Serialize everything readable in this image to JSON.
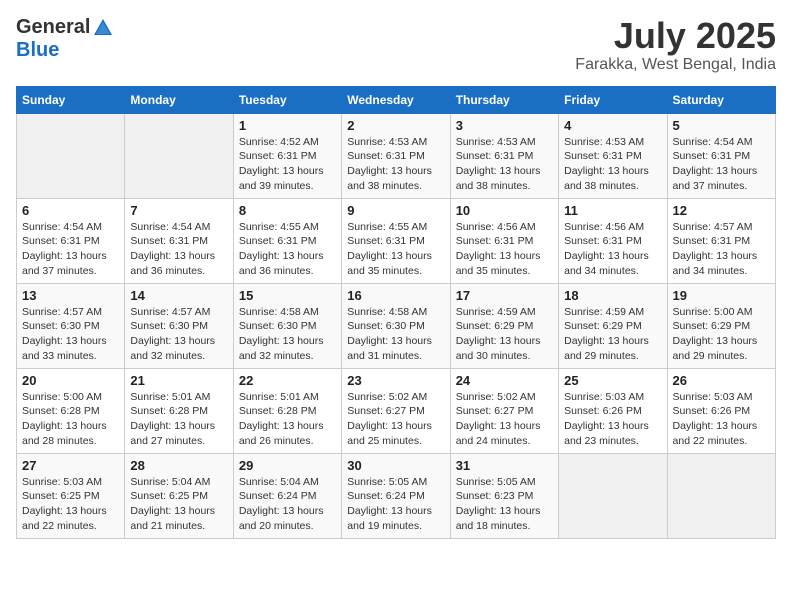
{
  "header": {
    "logo_general": "General",
    "logo_blue": "Blue",
    "month_title": "July 2025",
    "location": "Farakka, West Bengal, India"
  },
  "days_of_week": [
    "Sunday",
    "Monday",
    "Tuesday",
    "Wednesday",
    "Thursday",
    "Friday",
    "Saturday"
  ],
  "weeks": [
    [
      {
        "day": "",
        "info": ""
      },
      {
        "day": "",
        "info": ""
      },
      {
        "day": "1",
        "sunrise": "4:52 AM",
        "sunset": "6:31 PM",
        "daylight": "13 hours and 39 minutes."
      },
      {
        "day": "2",
        "sunrise": "4:53 AM",
        "sunset": "6:31 PM",
        "daylight": "13 hours and 38 minutes."
      },
      {
        "day": "3",
        "sunrise": "4:53 AM",
        "sunset": "6:31 PM",
        "daylight": "13 hours and 38 minutes."
      },
      {
        "day": "4",
        "sunrise": "4:53 AM",
        "sunset": "6:31 PM",
        "daylight": "13 hours and 38 minutes."
      },
      {
        "day": "5",
        "sunrise": "4:54 AM",
        "sunset": "6:31 PM",
        "daylight": "13 hours and 37 minutes."
      }
    ],
    [
      {
        "day": "6",
        "sunrise": "4:54 AM",
        "sunset": "6:31 PM",
        "daylight": "13 hours and 37 minutes."
      },
      {
        "day": "7",
        "sunrise": "4:54 AM",
        "sunset": "6:31 PM",
        "daylight": "13 hours and 36 minutes."
      },
      {
        "day": "8",
        "sunrise": "4:55 AM",
        "sunset": "6:31 PM",
        "daylight": "13 hours and 36 minutes."
      },
      {
        "day": "9",
        "sunrise": "4:55 AM",
        "sunset": "6:31 PM",
        "daylight": "13 hours and 35 minutes."
      },
      {
        "day": "10",
        "sunrise": "4:56 AM",
        "sunset": "6:31 PM",
        "daylight": "13 hours and 35 minutes."
      },
      {
        "day": "11",
        "sunrise": "4:56 AM",
        "sunset": "6:31 PM",
        "daylight": "13 hours and 34 minutes."
      },
      {
        "day": "12",
        "sunrise": "4:57 AM",
        "sunset": "6:31 PM",
        "daylight": "13 hours and 34 minutes."
      }
    ],
    [
      {
        "day": "13",
        "sunrise": "4:57 AM",
        "sunset": "6:30 PM",
        "daylight": "13 hours and 33 minutes."
      },
      {
        "day": "14",
        "sunrise": "4:57 AM",
        "sunset": "6:30 PM",
        "daylight": "13 hours and 32 minutes."
      },
      {
        "day": "15",
        "sunrise": "4:58 AM",
        "sunset": "6:30 PM",
        "daylight": "13 hours and 32 minutes."
      },
      {
        "day": "16",
        "sunrise": "4:58 AM",
        "sunset": "6:30 PM",
        "daylight": "13 hours and 31 minutes."
      },
      {
        "day": "17",
        "sunrise": "4:59 AM",
        "sunset": "6:29 PM",
        "daylight": "13 hours and 30 minutes."
      },
      {
        "day": "18",
        "sunrise": "4:59 AM",
        "sunset": "6:29 PM",
        "daylight": "13 hours and 29 minutes."
      },
      {
        "day": "19",
        "sunrise": "5:00 AM",
        "sunset": "6:29 PM",
        "daylight": "13 hours and 29 minutes."
      }
    ],
    [
      {
        "day": "20",
        "sunrise": "5:00 AM",
        "sunset": "6:28 PM",
        "daylight": "13 hours and 28 minutes."
      },
      {
        "day": "21",
        "sunrise": "5:01 AM",
        "sunset": "6:28 PM",
        "daylight": "13 hours and 27 minutes."
      },
      {
        "day": "22",
        "sunrise": "5:01 AM",
        "sunset": "6:28 PM",
        "daylight": "13 hours and 26 minutes."
      },
      {
        "day": "23",
        "sunrise": "5:02 AM",
        "sunset": "6:27 PM",
        "daylight": "13 hours and 25 minutes."
      },
      {
        "day": "24",
        "sunrise": "5:02 AM",
        "sunset": "6:27 PM",
        "daylight": "13 hours and 24 minutes."
      },
      {
        "day": "25",
        "sunrise": "5:03 AM",
        "sunset": "6:26 PM",
        "daylight": "13 hours and 23 minutes."
      },
      {
        "day": "26",
        "sunrise": "5:03 AM",
        "sunset": "6:26 PM",
        "daylight": "13 hours and 22 minutes."
      }
    ],
    [
      {
        "day": "27",
        "sunrise": "5:03 AM",
        "sunset": "6:25 PM",
        "daylight": "13 hours and 22 minutes."
      },
      {
        "day": "28",
        "sunrise": "5:04 AM",
        "sunset": "6:25 PM",
        "daylight": "13 hours and 21 minutes."
      },
      {
        "day": "29",
        "sunrise": "5:04 AM",
        "sunset": "6:24 PM",
        "daylight": "13 hours and 20 minutes."
      },
      {
        "day": "30",
        "sunrise": "5:05 AM",
        "sunset": "6:24 PM",
        "daylight": "13 hours and 19 minutes."
      },
      {
        "day": "31",
        "sunrise": "5:05 AM",
        "sunset": "6:23 PM",
        "daylight": "13 hours and 18 minutes."
      },
      {
        "day": "",
        "info": ""
      },
      {
        "day": "",
        "info": ""
      }
    ]
  ],
  "labels": {
    "sunrise_prefix": "Sunrise: ",
    "sunset_prefix": "Sunset: ",
    "daylight_label": "Daylight: "
  }
}
